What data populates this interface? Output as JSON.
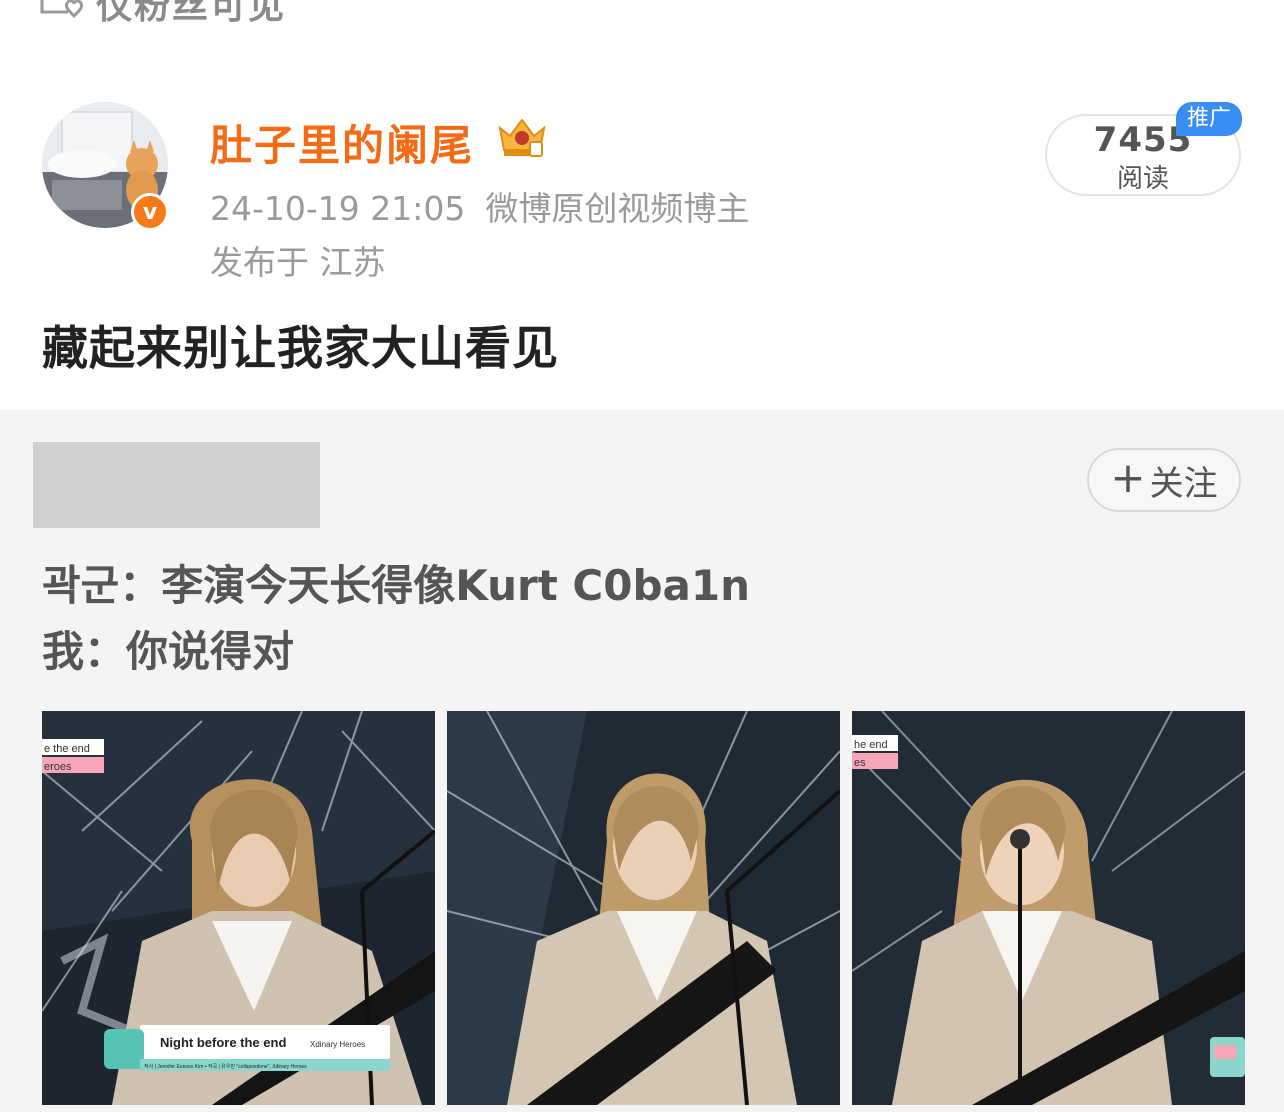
{
  "header": {
    "visibility_icon": "fans-only-heart-icon",
    "visibility_text": "仅粉丝可见"
  },
  "post": {
    "username": "肚子里的阑尾",
    "crown_icon": "member-crown-badge-icon",
    "verified_icon": "verified-v-icon",
    "timestamp": "24-10-19 21:05",
    "user_tag": "微博原创视频博主",
    "location": "发布于 江苏",
    "read_count": "7455",
    "read_label": "阅读",
    "promo_badge": "推广",
    "text": "藏起来别让我家大山看见",
    "colors": {
      "username": "#f56a14",
      "promo": "#3a8df3",
      "verified": "#f57b1a"
    }
  },
  "repost": {
    "follow_label": "关注",
    "line1": "곽군：李演今天长得像Kurt C0ba1n",
    "line2": "我：你说得对",
    "photos": [
      {
        "overlay_title": "Night before the end",
        "overlay_artist": "Xdinary Heroes",
        "overlay_credits": "작사 | Jennifer Eunsoo Kim • 작곡 | 유우민 \"collapsedone\", Xdinary Heroes",
        "top_caption_line1": "e the end",
        "top_caption_line2": "eroes"
      },
      {},
      {
        "top_caption_line1": "he end",
        "top_caption_line2": "es"
      }
    ]
  }
}
